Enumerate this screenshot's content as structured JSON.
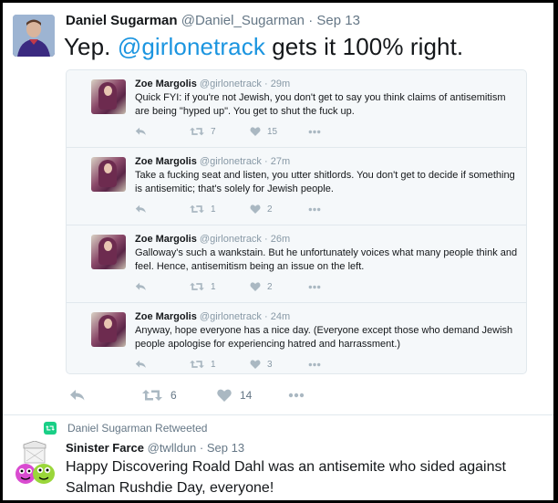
{
  "main_tweet": {
    "name": "Daniel Sugarman",
    "handle": "@Daniel_Sugarman",
    "time": "· Sep 13",
    "text_before": "Yep. ",
    "mention": "@girlonetrack",
    "text_after": " gets it 100% right.",
    "retweets": "6",
    "likes": "14"
  },
  "quoted": [
    {
      "name": "Zoe Margolis",
      "meta": "@girlonetrack · 29m",
      "text": "Quick FYI: if you're not Jewish, you don't get to say you think claims of antisemitism are being \"hyped up\". You get to shut the fuck up.",
      "retweets": "7",
      "likes": "15"
    },
    {
      "name": "Zoe Margolis",
      "meta": "@girlonetrack · 27m",
      "text": "Take a fucking seat and listen, you utter shitlords. You don't get to decide if something is antisemitic; that's solely for Jewish people.",
      "retweets": "1",
      "likes": "2"
    },
    {
      "name": "Zoe Margolis",
      "meta": "@girlonetrack · 26m",
      "text": "Galloway's such a wankstain. But he unfortunately voices what many people think and feel. Hence, antisemitism being an issue on the left.",
      "retweets": "1",
      "likes": "2"
    },
    {
      "name": "Zoe Margolis",
      "meta": "@girlonetrack · 24m",
      "text": "Anyway, hope everyone has a nice day. (Everyone except those who demand Jewish people apologise for experiencing hatred and harrassment.)",
      "retweets": "1",
      "likes": "3"
    }
  ],
  "retweet": {
    "label": "Daniel Sugarman Retweeted",
    "name": "Sinister Farce",
    "meta": "@twlldun · Sep 13",
    "text": "Happy Discovering Roald Dahl was an antisemite who sided against Salman Rushdie Day, everyone!"
  },
  "colors": {
    "link": "#1b95e0",
    "retweet_green": "#19cf86",
    "icon_gray": "#aab8c2"
  },
  "icons": [
    "reply-icon",
    "retweet-icon",
    "heart-icon",
    "more-icon"
  ]
}
